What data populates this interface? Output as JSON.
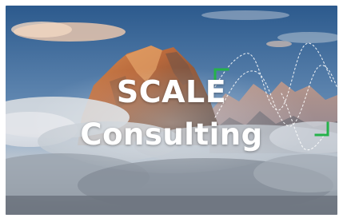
{
  "hero": {
    "title_line1": "SCALE",
    "title_line2": "Consulting"
  },
  "colors": {
    "accent_bracket": "#25b24a",
    "title_text": "#ffffff",
    "sky_top": "#2f5f93",
    "sky_bottom": "#9fb6cf"
  },
  "icons": {
    "corner_bracket_top_left": "corner-bracket-icon",
    "corner_bracket_bottom_right": "corner-bracket-icon",
    "dotted_wave": "dotted-wave-graphic"
  }
}
